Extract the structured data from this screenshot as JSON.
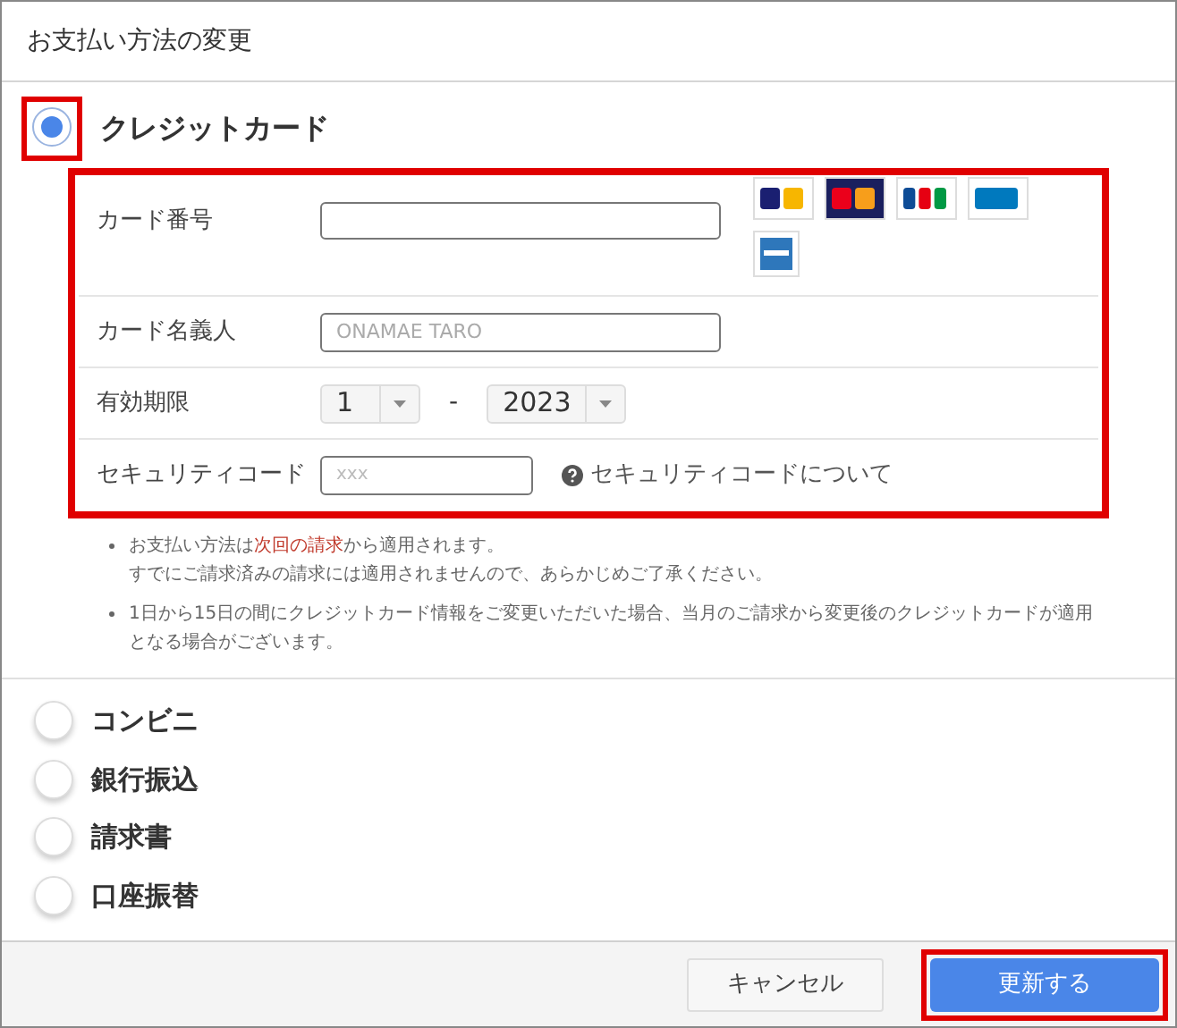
{
  "dialog": {
    "title": "お支払い方法の変更"
  },
  "credit_card": {
    "label": "クレジットカード",
    "selected": true,
    "highlighted": true
  },
  "card_form": {
    "highlighted": true,
    "fields": [
      {
        "kind": "card_number",
        "label": "カード番号"
      },
      {
        "kind": "text",
        "label": "カード名義人",
        "placeholder": "ONAMAE TARO"
      },
      {
        "kind": "expiry",
        "label": "有効期限",
        "month": "1",
        "separator": "-",
        "year": "2023"
      },
      {
        "kind": "security",
        "label": "セキュリティコード",
        "placeholder": "xxx",
        "help_link": "セキュリティコードについて"
      }
    ]
  },
  "notes": [
    {
      "lines": [
        [
          {
            "text": "お支払い方法は"
          },
          {
            "text": "次回の請求",
            "emphasis": true
          },
          {
            "text": "から適用されます。"
          }
        ],
        [
          {
            "text": "すでにご請求済みの請求には適用されませんので、あらかじめご了承ください。"
          }
        ]
      ]
    },
    {
      "lines": [
        [
          {
            "text": "1日から15日の間にクレジットカード情報をご変更いただいた場合、当月のご請求から変更後のクレジットカードが適用となる場合がございます。"
          }
        ]
      ]
    }
  ],
  "other_methods": [
    {
      "label": "コンビニ",
      "selected": false
    },
    {
      "label": "銀行振込",
      "selected": false
    },
    {
      "label": "請求書",
      "selected": false
    },
    {
      "label": "口座振替",
      "selected": false
    }
  ],
  "footer": {
    "buttons": [
      {
        "label": "キャンセル",
        "kind": "secondary",
        "highlighted": false
      },
      {
        "label": "更新する",
        "kind": "primary",
        "highlighted": true
      }
    ]
  }
}
